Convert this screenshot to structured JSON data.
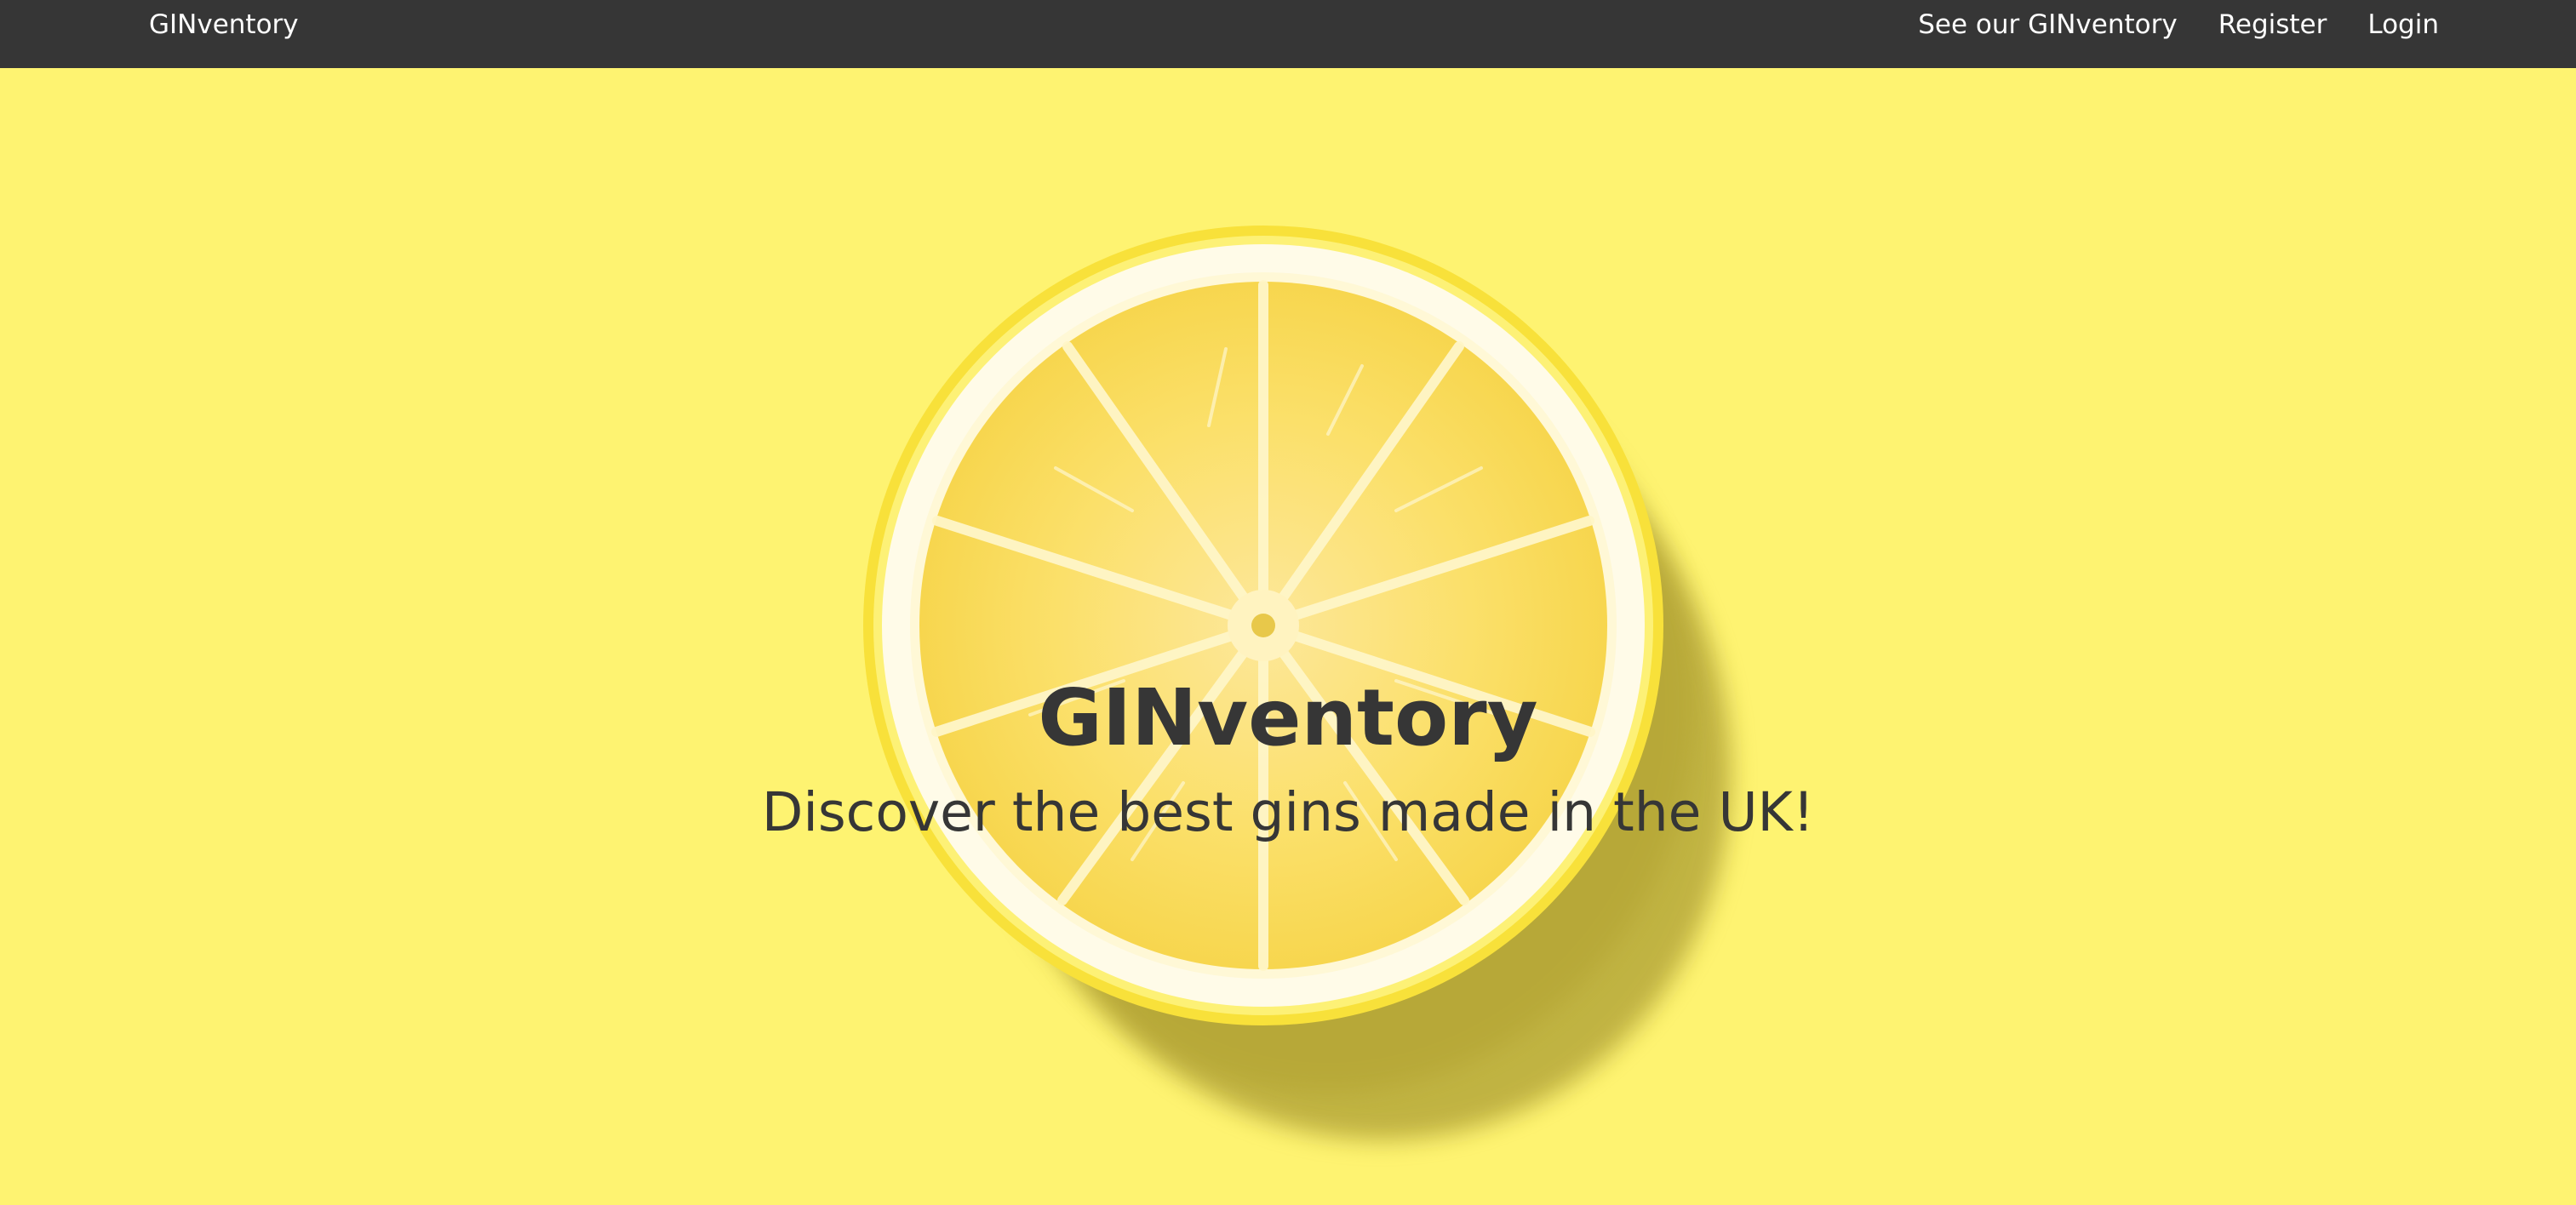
{
  "navbar": {
    "brand": "GINventory",
    "links": [
      {
        "label": "See our GINventory"
      },
      {
        "label": "Register"
      },
      {
        "label": "Login"
      }
    ]
  },
  "hero": {
    "title": "GINventory",
    "subtitle": "Discover the best gins made in the UK!",
    "image": "lemon-slice"
  },
  "colors": {
    "navbar_bg": "#363636",
    "nav_text": "#ffffff",
    "hero_bg": "#fef371",
    "hero_text": "#363636"
  }
}
